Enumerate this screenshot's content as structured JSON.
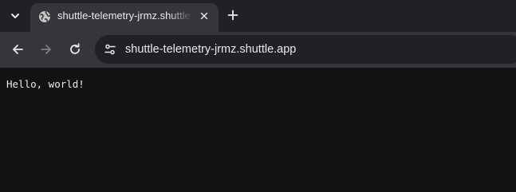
{
  "tabs": [
    {
      "title": "shuttle-telemetry-jrmz.shuttle.app",
      "favicon": "globe-icon",
      "active": true
    }
  ],
  "icons": {
    "tab_search": "chevron-down-icon",
    "tab_close": "close-icon",
    "new_tab": "plus-icon",
    "back": "arrow-left-icon",
    "forward": "arrow-right-icon",
    "reload": "reload-icon",
    "site_info": "tune-icon"
  },
  "toolbar": {
    "url": "shuttle-telemetry-jrmz.shuttle.app",
    "forward_enabled": false
  },
  "page": {
    "body_text": "Hello, world!"
  },
  "colors": {
    "tabstrip": "#202124",
    "active_tab": "#35363a",
    "toolbar": "#35363a",
    "omnibox": "#202124",
    "page_background": "#121212",
    "text": "#e8eaed",
    "disabled_icon": "#7d7e82"
  }
}
